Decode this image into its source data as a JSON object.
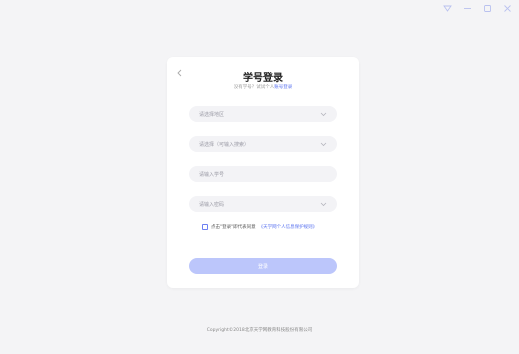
{
  "window": {
    "controls": [
      "pin-icon",
      "minimize-icon",
      "maximize-icon",
      "close-icon"
    ],
    "accent": "#5b74f0"
  },
  "card": {
    "title": "学号登录",
    "subtitle_prefix": "没有学号？试试个人",
    "subtitle_link": "账号登录",
    "fields": {
      "school": {
        "placeholder": "请选择地区"
      },
      "school2": {
        "placeholder": "请选择（可输入搜索）"
      },
      "student_id": {
        "placeholder": "请输入学号"
      },
      "password": {
        "placeholder": "请输入密码"
      }
    },
    "agree_text": "点击\"登录\"即代表同意",
    "agree_link": "《天学网个人信息保护规则》",
    "login_label": "登录"
  },
  "footer": {
    "copyright": "Copyright©2018北京天学网教育科技股份有限公司"
  }
}
